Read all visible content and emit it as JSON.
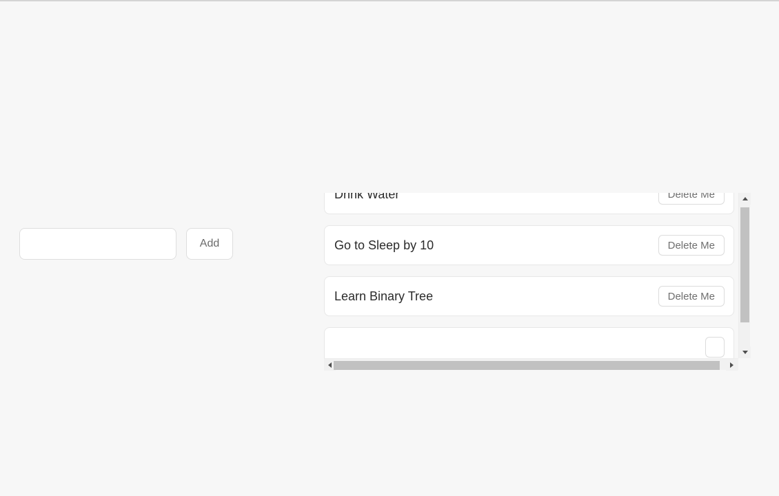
{
  "page": {
    "background_color": "#f7f7f7"
  },
  "add_form": {
    "input_value": "",
    "input_placeholder": "",
    "add_label": "Add"
  },
  "todo_list": {
    "delete_label": "Delete Me",
    "items": [
      {
        "text": "Drink Water",
        "delete_label": "Delete Me"
      },
      {
        "text": "Go to Sleep by 10",
        "delete_label": "Delete Me"
      },
      {
        "text": "Learn Binary Tree",
        "delete_label": "Delete Me"
      },
      {
        "text": "",
        "delete_label": ""
      }
    ]
  },
  "scrollbars": {
    "vertical": {
      "up_arrow_icon": "triangle-up-icon",
      "down_arrow_icon": "triangle-down-icon",
      "thumb_color": "#c1c1c1",
      "track_color": "#f1f1f1"
    },
    "horizontal": {
      "left_arrow_icon": "triangle-left-icon",
      "right_arrow_icon": "triangle-right-icon",
      "thumb_color": "#c1c1c1",
      "track_color": "#f1f1f1"
    }
  }
}
